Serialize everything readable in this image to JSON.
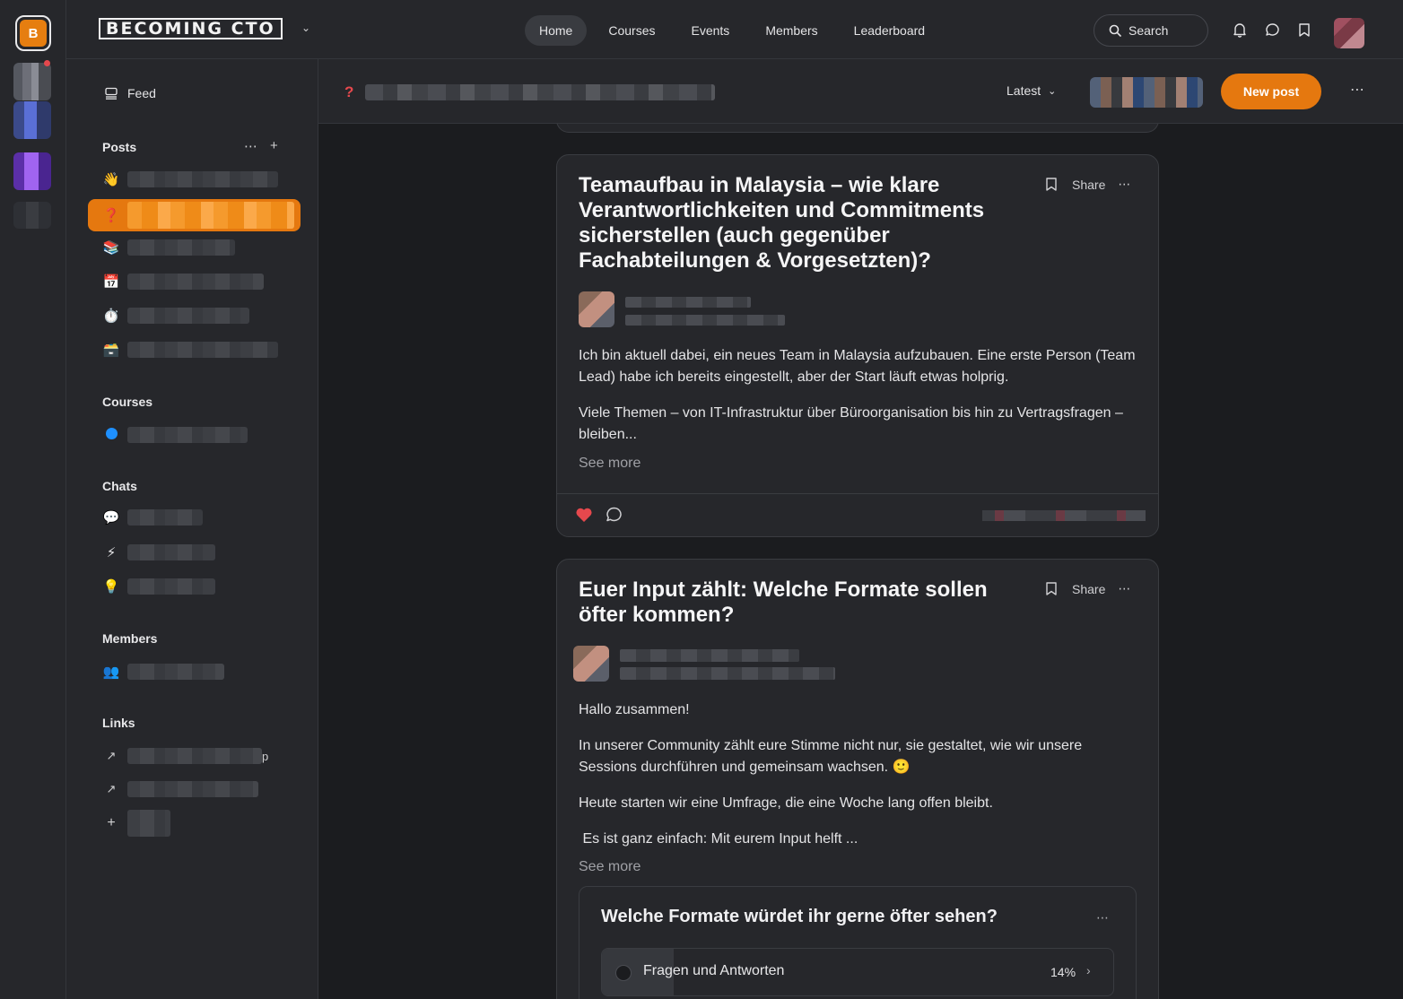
{
  "rail": {
    "logo_letter": "B"
  },
  "brand": {
    "name": "BECOMING CTO"
  },
  "nav": {
    "items": [
      {
        "label": "Home",
        "active": true
      },
      {
        "label": "Courses",
        "active": false
      },
      {
        "label": "Events",
        "active": false
      },
      {
        "label": "Members",
        "active": false
      },
      {
        "label": "Leaderboard",
        "active": false
      }
    ],
    "search_label": "Search"
  },
  "sidebar": {
    "feed_label": "Feed",
    "posts_heading": "Posts",
    "post_spaces": [
      {
        "emoji": "👋",
        "active": false
      },
      {
        "emoji": "❓",
        "active": true
      },
      {
        "emoji": "📚",
        "active": false
      },
      {
        "emoji": "📅",
        "active": false
      },
      {
        "emoji": "⏱️",
        "active": false
      },
      {
        "emoji": "🗃️",
        "active": false
      }
    ],
    "courses_heading": "Courses",
    "chats_heading": "Chats",
    "members_heading": "Members",
    "links_heading": "Links",
    "link_suffix": "p"
  },
  "content_header": {
    "sort_label": "Latest",
    "new_post_label": "New post"
  },
  "posts": [
    {
      "title": "Teamaufbau in Malaysia – wie klare Verantwortlichkeiten und Commitments sicherstellen (auch gegenüber Fachabteilungen & Vorgesetzten)?",
      "share_label": "Share",
      "paragraphs": [
        "Ich bin aktuell dabei, ein neues Team in Malaysia aufzubauen. Eine erste Person (Team Lead) habe ich bereits eingestellt, aber der Start läuft etwas holprig.",
        "Viele Themen – von IT-Infrastruktur über Büroorganisation bis hin zu Vertragsfragen – bleiben..."
      ],
      "see_more": "See more",
      "liked": true
    },
    {
      "title": "Euer Input zählt: Welche Formate sollen öfter kommen?",
      "share_label": "Share",
      "paragraphs": [
        "Hallo zusammen!",
        "In unserer Community zählt eure Stimme nicht nur, sie gestaltet, wie wir unsere Sessions durchführen und gemeinsam wachsen. 🙂",
        "Heute starten wir eine Umfrage, die eine Woche lang offen bleibt.",
        " Es ist ganz einfach: Mit eurem Input helft ..."
      ],
      "see_more": "See more",
      "poll": {
        "question": "Welche Formate würdet ihr gerne öfter sehen?",
        "options": [
          {
            "label": "Fragen und Antworten",
            "percent_label": "14%",
            "percent": 14
          }
        ]
      }
    }
  ],
  "colors": {
    "accent": "#e5780f",
    "like": "#e5484d",
    "background": "#1b1c1f",
    "surface": "#26272b"
  }
}
